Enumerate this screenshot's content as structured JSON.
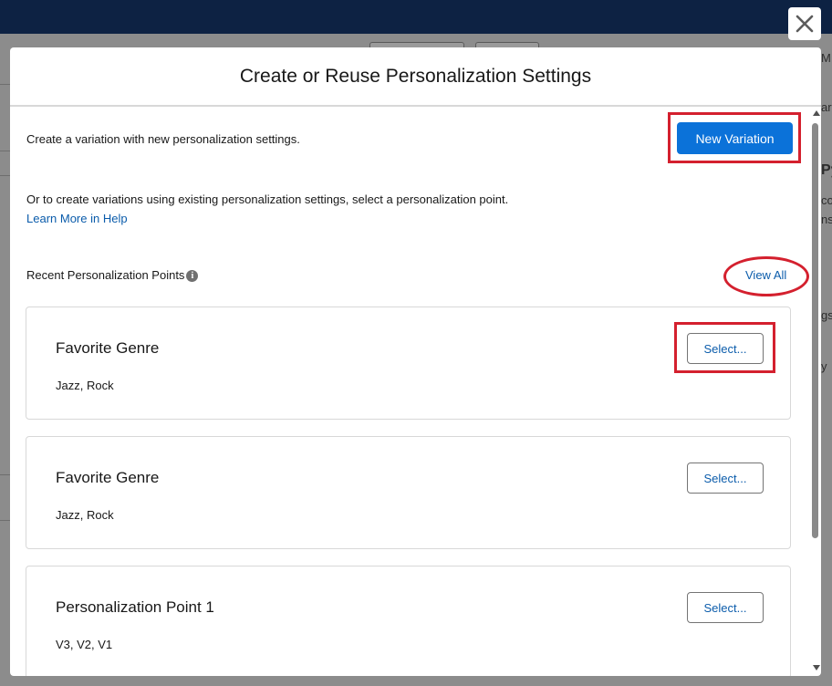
{
  "background": {
    "fragments": [
      "M",
      "ar",
      "Py",
      "co",
      "ns",
      "gs",
      "y"
    ]
  },
  "modal": {
    "title": "Create or Reuse Personalization Settings",
    "intro_text": "Create a variation with new personalization settings.",
    "new_variation_label": "New Variation",
    "or_text": "Or to create variations using existing personalization settings, select a personalization point.",
    "help_link": "Learn More in Help",
    "recent_label": "Recent Personalization Points",
    "view_all_label": "View All",
    "select_label": "Select...",
    "cards": [
      {
        "title": "Favorite Genre",
        "values": "Jazz,  Rock"
      },
      {
        "title": "Favorite Genre",
        "values": "Jazz,  Rock"
      },
      {
        "title": "Personalization Point 1",
        "values": "V3,  V2,  V1"
      }
    ]
  },
  "colors": {
    "brand_blue": "#0b72d9",
    "link_blue": "#0b5cab",
    "annotation_red": "#d4202e",
    "header_navy": "#0d2243"
  },
  "icons": {
    "close": "close-icon",
    "info": "info-icon"
  }
}
